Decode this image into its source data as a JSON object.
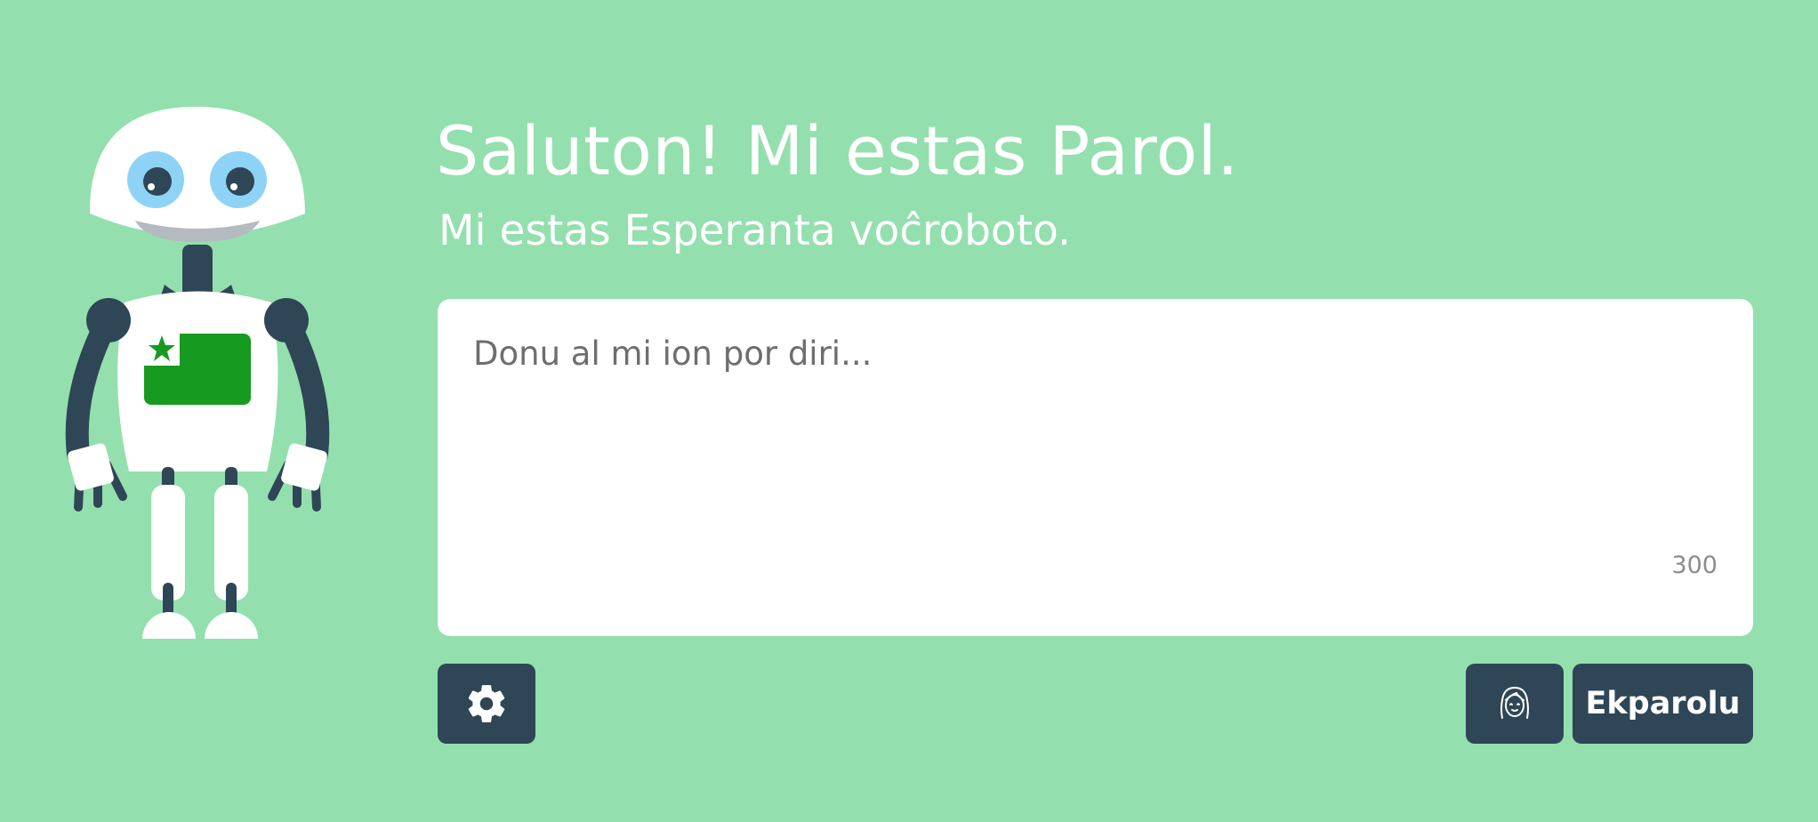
{
  "header": {
    "title": "Saluton! Mi estas Parol.",
    "subtitle": "Mi estas Esperanta voĉroboto."
  },
  "speech": {
    "placeholder": "Donu al mi ion por diri...",
    "value": "",
    "char_count": "300"
  },
  "controls": {
    "settings_icon": "gear-icon",
    "voice_icon": "female-face-icon",
    "speak_label": "Ekparolu"
  },
  "colors": {
    "background": "#94dfae",
    "button": "#2f4657",
    "robot_flag": "#169b20",
    "robot_eye": "#8ed3f6"
  }
}
